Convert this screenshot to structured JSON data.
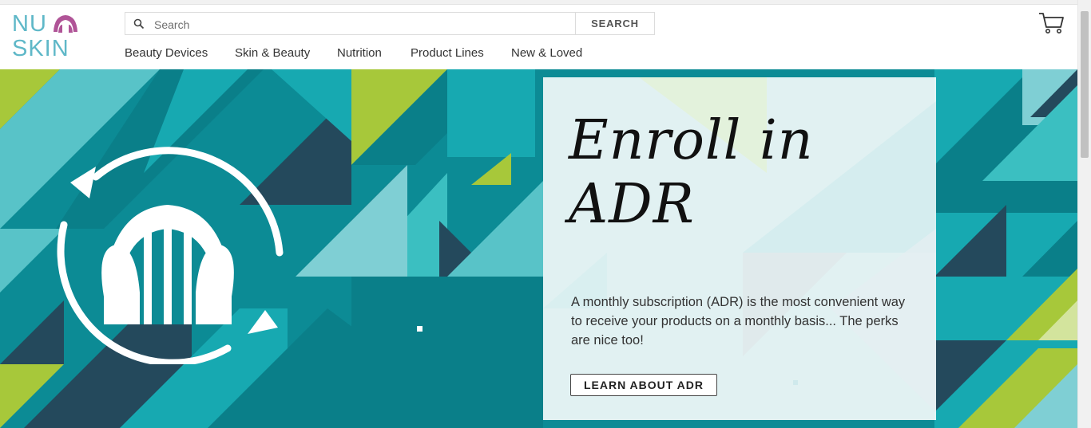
{
  "brand": {
    "logo_line1": "NU",
    "logo_line2": "SKIN",
    "logo_name": "nu-skin-logo"
  },
  "search": {
    "placeholder": "Search",
    "button_label": "SEARCH",
    "icon": "search-icon"
  },
  "nav": {
    "items": [
      "Beauty Devices",
      "Skin & Beauty",
      "Nutrition",
      "Product Lines",
      "New & Loved"
    ]
  },
  "cart": {
    "icon": "cart-icon"
  },
  "hero": {
    "title_line1": "Enroll in",
    "title_line2": "ADR",
    "description": "A monthly subscription (ADR) is the most convenient way to receive your products on a monthly basis... The perks are nice too!",
    "cta_label": "LEARN ABOUT ADR",
    "icon": "adr-refresh-icon"
  },
  "colors": {
    "teal_dark": "#0a7f89",
    "teal": "#17a9b1",
    "teal_light": "#7fcfd4",
    "navy": "#24495c",
    "lime": "#a7c83a",
    "logo_teal": "#5fb8c8",
    "logo_magenta": "#b05497"
  }
}
